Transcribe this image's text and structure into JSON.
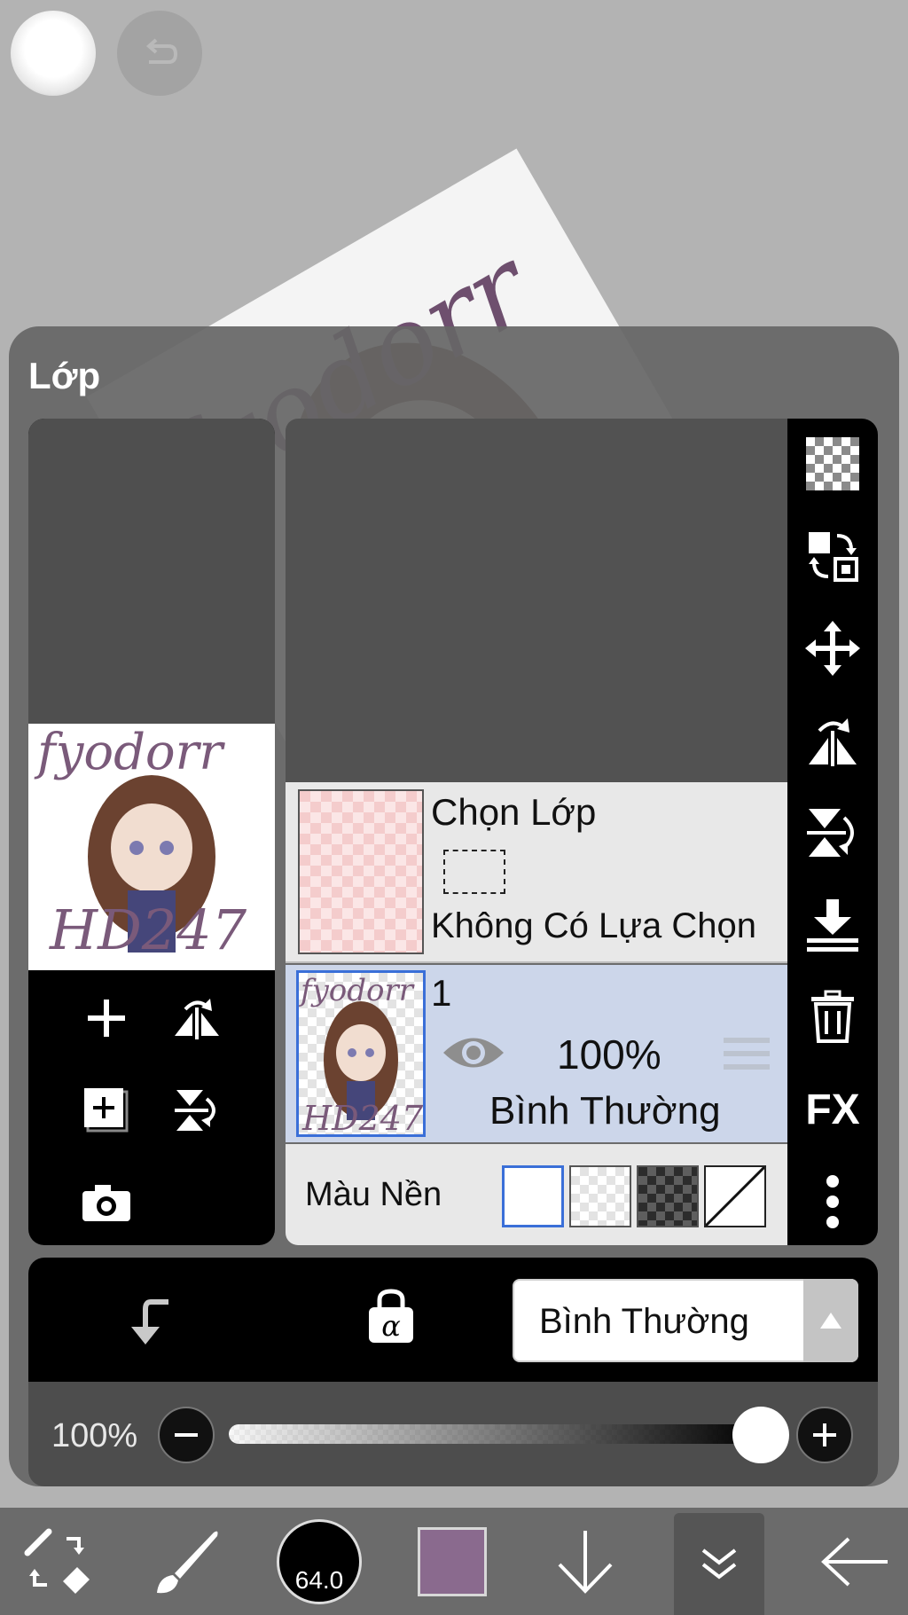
{
  "panel": {
    "title": "Lớp"
  },
  "artwork": {
    "watermark_top": "fyodorr",
    "watermark_bottom": "HD247"
  },
  "layers": {
    "selection_layer": {
      "name": "Chọn Lớp",
      "status": "Không Có Lựa Chọn"
    },
    "layer_1": {
      "name": "1",
      "opacity": "100%",
      "blend_mode": "Bình Thường"
    }
  },
  "background_color": {
    "label": "Màu Nền",
    "options": [
      "white",
      "light-checker",
      "dark-checker",
      "none"
    ],
    "selected": "white"
  },
  "blend": {
    "selected": "Bình Thường"
  },
  "opacity": {
    "value_label": "100%",
    "value": 1.0
  },
  "bottom_toolbar": {
    "brush_size": "64.0",
    "color": "#8a6a8e"
  },
  "right_toolbar": {
    "fx_label": "FX"
  },
  "colors": {
    "accent_blue": "#3a6fd8",
    "selected_row": "#ccd6ea",
    "watermark": "#6e4f6e"
  }
}
